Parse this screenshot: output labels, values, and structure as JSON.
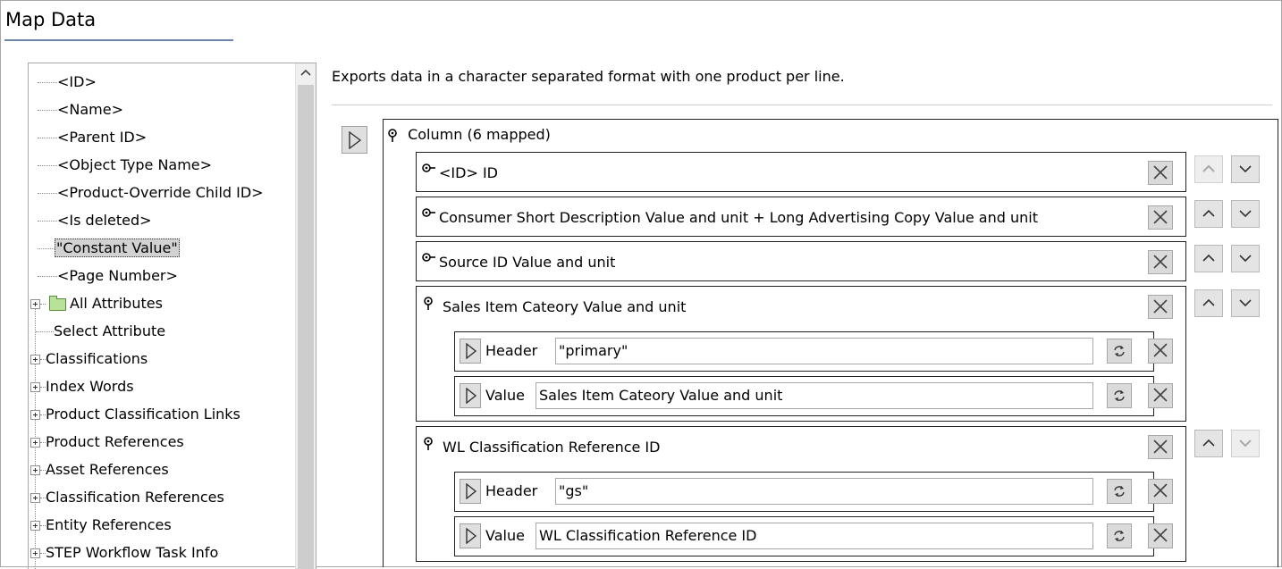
{
  "panel": {
    "title": "Map Data"
  },
  "tree": {
    "items": [
      {
        "label": "<ID>"
      },
      {
        "label": "<Name>"
      },
      {
        "label": "<Parent ID>"
      },
      {
        "label": "<Object Type Name>"
      },
      {
        "label": "<Product-Override Child ID>"
      },
      {
        "label": "<Is deleted>"
      },
      {
        "label": "\"Constant Value\"",
        "selected": true
      },
      {
        "label": "<Page Number>"
      },
      {
        "label": "All Attributes",
        "expandable": true,
        "icon": "folder-icon"
      },
      {
        "label": "Select Attribute"
      },
      {
        "label": "Classifications",
        "expandable": true
      },
      {
        "label": "Index Words",
        "expandable": true
      },
      {
        "label": "Product Classification Links",
        "expandable": true
      },
      {
        "label": "Product References",
        "expandable": true
      },
      {
        "label": "Asset References",
        "expandable": true
      },
      {
        "label": "Classification References",
        "expandable": true
      },
      {
        "label": "Entity References",
        "expandable": true
      },
      {
        "label": "STEP Workflow Task Info",
        "expandable": true
      }
    ]
  },
  "main": {
    "description": "Exports data in a character separated format with one product per line.",
    "column": {
      "label": "Column (6 mapped)",
      "entries": [
        {
          "label": "<ID> ID",
          "icon": "key-icon",
          "up_enabled": false,
          "down_enabled": true
        },
        {
          "label": "Consumer Short Description Value and unit + Long Advertising Copy Value and unit",
          "icon": "key-icon",
          "up_enabled": true,
          "down_enabled": true
        },
        {
          "label": "Source ID Value and unit",
          "icon": "key-icon",
          "up_enabled": true,
          "down_enabled": true
        },
        {
          "label": "Sales Item Cateory Value and unit",
          "icon": "pin-icon",
          "up_enabled": true,
          "down_enabled": true,
          "sub": [
            {
              "label": "Header",
              "value": "\"primary\""
            },
            {
              "label": "Value",
              "value": "Sales Item Cateory Value and unit"
            }
          ]
        },
        {
          "label": "WL Classification Reference ID",
          "icon": "pin-icon",
          "up_enabled": true,
          "down_enabled": false,
          "sub": [
            {
              "label": "Header",
              "value": "\"gs\""
            },
            {
              "label": "Value",
              "value": "WL Classification Reference ID"
            }
          ]
        }
      ]
    }
  }
}
